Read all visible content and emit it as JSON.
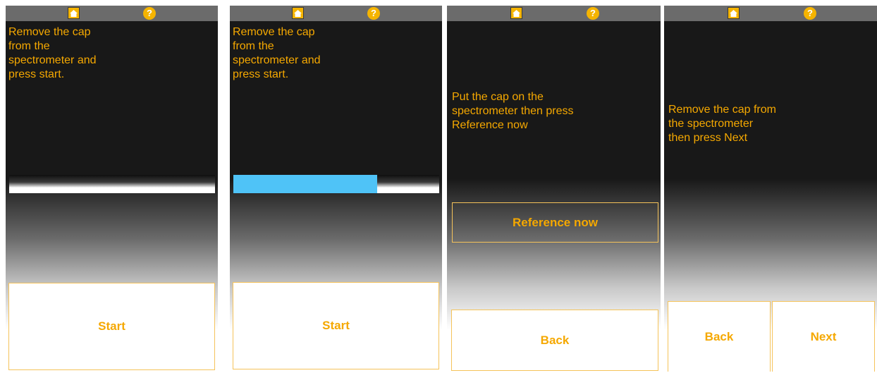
{
  "accent": "#f5a800",
  "progress_color": "#4fc3f7",
  "icons": {
    "home": "home-icon",
    "help": "help-icon",
    "help_glyph": "?"
  },
  "screens": [
    {
      "message_lines": [
        "Remove the cap",
        "from the",
        "spectrometer and",
        "press start."
      ],
      "progress_percent": 0,
      "buttons": {
        "start": "Start"
      }
    },
    {
      "message_lines": [
        "Remove the cap",
        "from the",
        "spectrometer and",
        "press start."
      ],
      "progress_percent": 70,
      "buttons": {
        "start": "Start"
      }
    },
    {
      "message_lines": [
        "Put the cap on the",
        "spectrometer then press",
        "Reference now"
      ],
      "buttons": {
        "reference": "Reference now",
        "back": "Back"
      }
    },
    {
      "message_lines": [
        "Remove the cap from",
        "the spectrometer",
        "then press Next"
      ],
      "buttons": {
        "back": "Back",
        "next": "Next"
      }
    }
  ]
}
